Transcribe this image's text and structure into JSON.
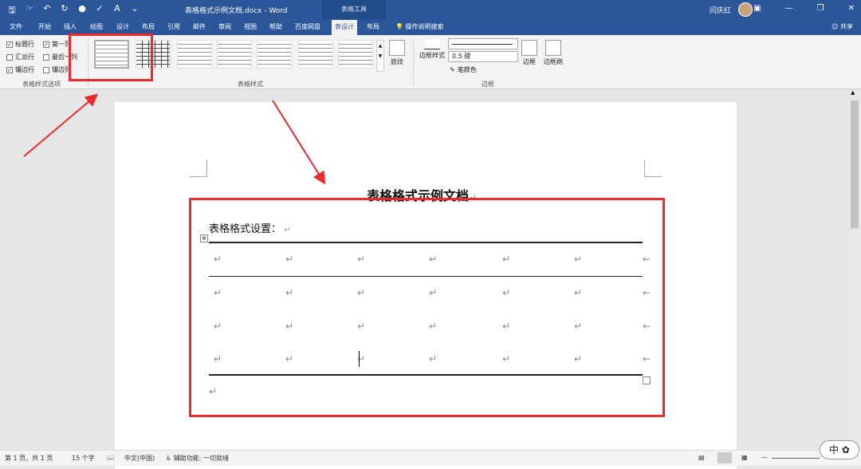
{
  "window": {
    "doc_title": "表格格式示例文档.docx - Word",
    "context_title": "表格工具",
    "user": "闫庆红"
  },
  "qat": [
    "save-icon",
    "touch-icon",
    "undo-icon",
    "redo-icon",
    "record-icon",
    "spell-icon",
    "font-icon",
    "more-icon"
  ],
  "tabs": [
    "文件",
    "开始",
    "插入",
    "绘图",
    "设计",
    "布局",
    "引用",
    "邮件",
    "审阅",
    "视图",
    "帮助",
    "百度网盘",
    "表设计",
    "布局"
  ],
  "active_tab": "表设计",
  "tell_me": "操作说明搜索",
  "share": "共享",
  "style_options": {
    "items": [
      {
        "label": "标题行",
        "checked": true
      },
      {
        "label": "第一列",
        "checked": true
      },
      {
        "label": "汇总行",
        "checked": false
      },
      {
        "label": "最后一列",
        "checked": false
      },
      {
        "label": "镶边行",
        "checked": true
      },
      {
        "label": "镶边列",
        "checked": false
      }
    ],
    "group_label": "表格样式选项"
  },
  "table_styles": {
    "group_label": "表格样式",
    "shading_label": "底纹"
  },
  "borders": {
    "border_styles_label": "边框样式",
    "weight": "0.5 磅",
    "pen_color_label": "笔颜色",
    "borders_label": "边框",
    "painter_label": "边框刷",
    "group_label": "边框"
  },
  "document": {
    "heading": "表格格式示例文档",
    "table_caption": "表格格式设置：",
    "rows": 4,
    "cols": 7
  },
  "status": {
    "page": "第 1 页，共 1 页",
    "words": "15 个字",
    "language": "中文(中国)",
    "accessibility": "辅助功能: 一切就绪"
  },
  "ime": "中"
}
